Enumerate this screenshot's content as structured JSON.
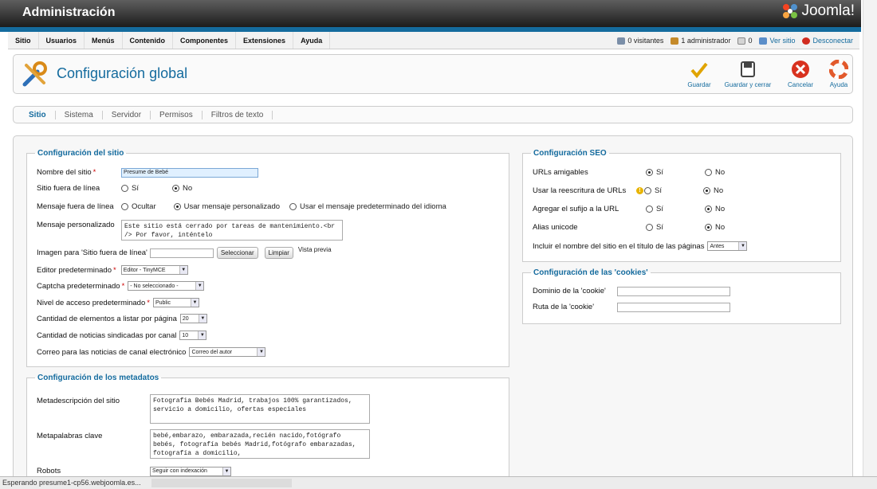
{
  "header": {
    "title": "Administración",
    "logo_text": "Joomla!"
  },
  "menu": [
    "Sitio",
    "Usuarios",
    "Menús",
    "Contenido",
    "Componentes",
    "Extensiones",
    "Ayuda"
  ],
  "status": {
    "visitors": "0 visitantes",
    "admins": "1 administrador",
    "messages": "0",
    "view_site": "Ver sitio",
    "logout": "Desconectar"
  },
  "toolbar": {
    "title": "Configuración global",
    "save": "Guardar",
    "save_close": "Guardar y cerrar",
    "cancel": "Cancelar",
    "help": "Ayuda"
  },
  "tabs": [
    "Sitio",
    "Sistema",
    "Servidor",
    "Permisos",
    "Filtros de texto"
  ],
  "site": {
    "legend": "Configuración del sitio",
    "site_name_label": "Nombre del sitio",
    "site_name_value": "Presume de Bebé",
    "offline_label": "Sitio fuera de línea",
    "yes": "Sí",
    "no": "No",
    "offline_msg_label": "Mensaje fuera de línea",
    "opt_hide": "Ocultar",
    "opt_custom": "Usar mensaje personalizado",
    "opt_lang": "Usar el mensaje predeterminado del idioma",
    "custom_msg_label": "Mensaje personalizado",
    "custom_msg_value": "Este sitio está cerrado por tareas de mantenimiento.<br /> Por favor, inténtelo",
    "offline_img_label": "Imagen para 'Sitio fuera de línea'",
    "select_btn": "Seleccionar",
    "clear_btn": "Limpiar",
    "preview": "Vista previa",
    "editor_label": "Editor predeterminado",
    "editor_value": "Editor - TinyMCE",
    "captcha_label": "Captcha predeterminado",
    "captcha_value": "- No seleccionado -",
    "access_label": "Nivel de acceso predeterminado",
    "access_value": "Public",
    "list_label": "Cantidad de elementos a listar por página",
    "list_value": "20",
    "feed_label": "Cantidad de noticias sindicadas por canal",
    "feed_value": "10",
    "email_label": "Correo para las noticias de canal electrónico",
    "email_value": "Correo del autor"
  },
  "meta": {
    "legend": "Configuración de los metadatos",
    "desc_label": "Metadescripción del sitio",
    "desc_value": "Fotografia Bebés Madrid, trabajos 100% garantizados, servicio a domicilio, ofertas especiales",
    "keys_label": "Metapalabras clave",
    "keys_value": "bebé,embarazo, embarazada,recién nacido,fotógrafo bebés, fotografía bebés Madrid,fotógrafo embarazadas, fotografía a domicilio,",
    "robots_label": "Robots",
    "robots_value": "Seguir con indexación"
  },
  "seo": {
    "legend": "Configuración SEO",
    "friendly_label": "URLs amigables",
    "rewrite_label": "Usar la reescritura de URLs",
    "suffix_label": "Agregar el sufijo a la URL",
    "unicode_label": "Alias unicode",
    "yes": "Sí",
    "no": "No",
    "sitename_label": "Incluir el nombre del sitio en el título de las páginas",
    "sitename_value": "Antes"
  },
  "cookies": {
    "legend": "Configuración de las 'cookies'",
    "domain_label": "Dominio de la 'cookie'",
    "path_label": "Ruta de la 'cookie'"
  },
  "statusbar": {
    "text": "Esperando presume1-cp56.webjoomla.es..."
  }
}
